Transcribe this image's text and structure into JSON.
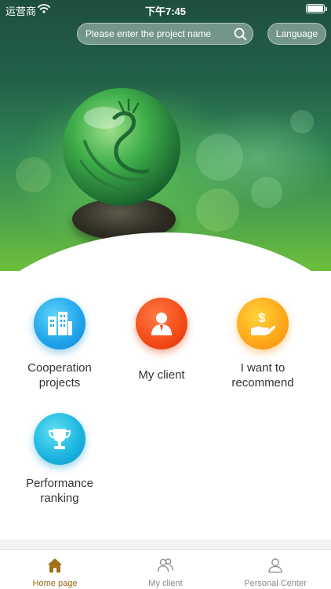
{
  "status_bar": {
    "carrier": "运营商",
    "time": "下午7:45"
  },
  "search": {
    "placeholder": "Please enter the project name"
  },
  "language_button": "Language",
  "features": [
    {
      "label_line1": "Cooperation",
      "label_line2": "projects",
      "icon": "building-icon",
      "color": "#1ea3ea"
    },
    {
      "label_line1": "My client",
      "label_line2": "",
      "icon": "person-icon",
      "color": "#f34a17"
    },
    {
      "label_line1": "I want to",
      "label_line2": "recommend",
      "icon": "hand-money-icon",
      "color": "#fda719"
    },
    {
      "label_line1": "Performance",
      "label_line2": "ranking",
      "icon": "trophy-icon",
      "color": "#1ab3e0"
    }
  ],
  "tab_bar": {
    "tabs": [
      {
        "label": "Home page",
        "icon": "home-icon",
        "active": true
      },
      {
        "label": "My client",
        "icon": "users-icon",
        "active": false
      },
      {
        "label": "Personal Center",
        "icon": "user-icon",
        "active": false
      }
    ],
    "active_color": "#9a6a14",
    "inactive_color": "#8a8a8a"
  }
}
